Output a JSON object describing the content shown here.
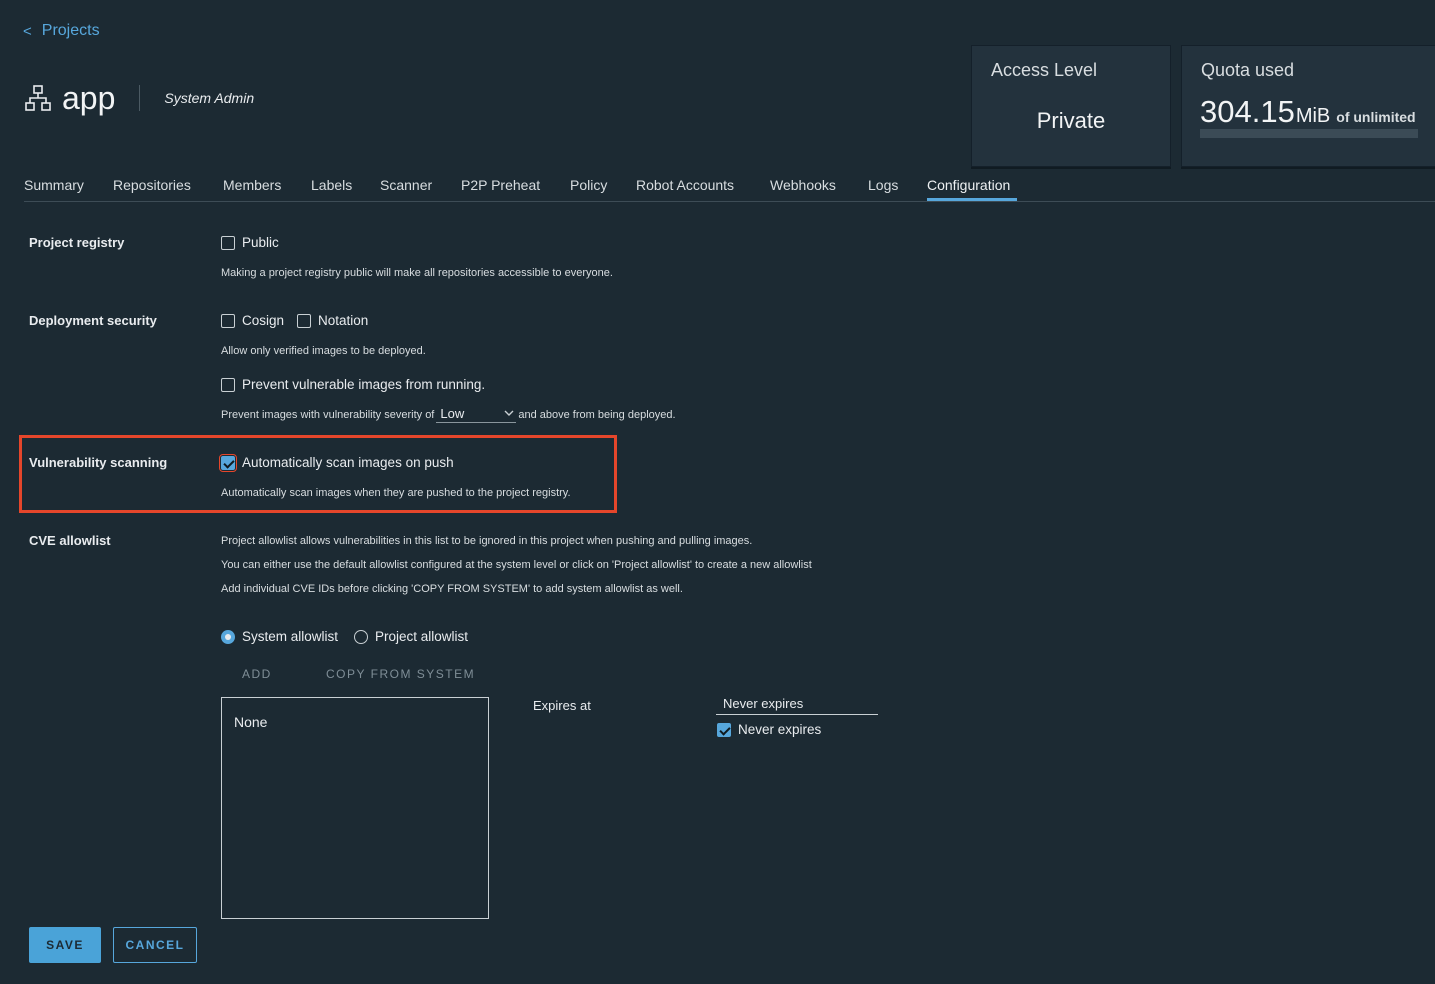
{
  "breadcrumb": {
    "label": "Projects"
  },
  "project": {
    "name": "app",
    "role": "System Admin"
  },
  "cards": {
    "access": {
      "title": "Access Level",
      "value": "Private"
    },
    "quota": {
      "title": "Quota used",
      "value": "304.15",
      "unit": "MiB",
      "limit": "of unlimited",
      "fill_fraction": 0
    }
  },
  "tabs": [
    "Summary",
    "Repositories",
    "Members",
    "Labels",
    "Scanner",
    "P2P Preheat",
    "Policy",
    "Robot Accounts",
    "Webhooks",
    "Logs",
    "Configuration"
  ],
  "active_tab": "Configuration",
  "config": {
    "registry": {
      "label": "Project registry",
      "public_label": "Public",
      "public_checked": false,
      "help": "Making a project registry public will make all repositories accessible to everyone."
    },
    "deployment": {
      "label": "Deployment security",
      "cosign_label": "Cosign",
      "cosign_checked": false,
      "notation_label": "Notation",
      "notation_checked": false,
      "help": "Allow only verified images to be deployed.",
      "prevent_label": "Prevent vulnerable images from running.",
      "prevent_checked": false,
      "severity_prefix": "Prevent images with vulnerability severity of",
      "severity_value": "Low",
      "severity_suffix": "and above from being deployed."
    },
    "vuln": {
      "label": "Vulnerability scanning",
      "auto_label": "Automatically scan images on push",
      "auto_checked": true,
      "help": "Automatically scan images when they are pushed to the project registry."
    },
    "cve": {
      "label": "CVE allowlist",
      "line1": "Project allowlist allows vulnerabilities in this list to be ignored in this project when pushing and pulling images.",
      "line2": "You can either use the default allowlist configured at the system level or click on 'Project allowlist' to create a new allowlist",
      "line3": "Add individual CVE IDs before clicking 'COPY FROM SYSTEM' to add system allowlist as well.",
      "system_label": "System allowlist",
      "project_label": "Project allowlist",
      "selected": "system",
      "add_label": "ADD",
      "copy_label": "COPY FROM SYSTEM",
      "items": [
        "None"
      ],
      "expires_label": "Expires at",
      "expires_value": "Never expires",
      "never_label": "Never expires",
      "never_checked": true
    }
  },
  "actions": {
    "save": "SAVE",
    "cancel": "CANCEL"
  },
  "colors": {
    "accent": "#57a7dc",
    "highlight": "#e5462b",
    "background": "#1c2a33"
  }
}
